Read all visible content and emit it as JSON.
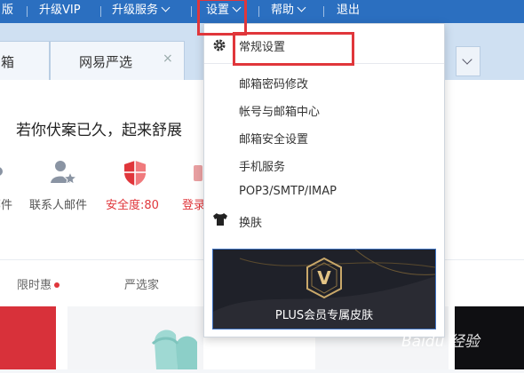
{
  "topnav": {
    "items": [
      {
        "label": "版"
      },
      {
        "label": "升级VIP"
      },
      {
        "label": "升级服务"
      },
      {
        "label": "设置"
      },
      {
        "label": "帮助"
      },
      {
        "label": "退出"
      }
    ]
  },
  "tabs": [
    {
      "label": "箱"
    },
    {
      "label": "网易严选",
      "close": "×"
    }
  ],
  "greeting": "若你伏案已久，起来舒展",
  "quick_links": [
    {
      "label": "邮件"
    },
    {
      "label": "联系人邮件"
    },
    {
      "label": "安全度:80"
    },
    {
      "label": "登录"
    }
  ],
  "subnav": [
    {
      "label": "限时惠"
    },
    {
      "label": "严选家"
    }
  ],
  "settings_menu": {
    "items": [
      {
        "label": "常规设置",
        "icon": "gear-icon"
      },
      {
        "label": "邮箱密码修改"
      },
      {
        "label": "帐号与邮箱中心"
      },
      {
        "label": "邮箱安全设置"
      },
      {
        "label": "手机服务"
      },
      {
        "label": "POP3/SMTP/IMAP"
      },
      {
        "label": "换肤",
        "icon": "tshirt-icon"
      }
    ],
    "banner": {
      "text": "PLUS会员专属皮肤",
      "badge": "V"
    }
  },
  "watermark": "Baidu 经验",
  "colors": {
    "topbar": "#2b6fc0",
    "highlight": "#e0363b",
    "security": "#e0363b",
    "banner_bg": "#1f2129",
    "banner_gold": "#c9a86a"
  }
}
